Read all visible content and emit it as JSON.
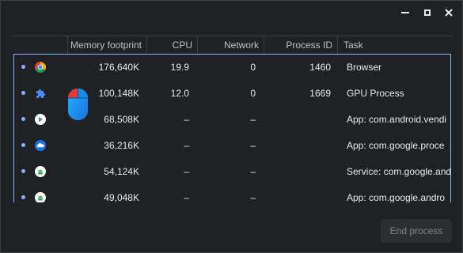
{
  "columns": {
    "memory": "Memory footprint",
    "cpu": "CPU",
    "network": "Network",
    "pid": "Process ID",
    "task": "Task"
  },
  "rows": [
    {
      "icon": "chrome-icon",
      "memory": "176,640K",
      "cpu": "19.9",
      "network": "0",
      "pid": "1460",
      "task": "Browser"
    },
    {
      "icon": "puzzle-piece-icon",
      "memory": "100,148K",
      "cpu": "12.0",
      "network": "0",
      "pid": "1669",
      "task": "GPU Process"
    },
    {
      "icon": "play-store-icon",
      "memory": "68,508K",
      "cpu": "–",
      "network": "–",
      "pid": "",
      "task": "App: com.android.vendi"
    },
    {
      "icon": "cloud-icon",
      "memory": "36,216K",
      "cpu": "–",
      "network": "–",
      "pid": "",
      "task": "App: com.google.proce"
    },
    {
      "icon": "android-icon",
      "memory": "54,124K",
      "cpu": "–",
      "network": "–",
      "pid": "",
      "task": "Service: com.google.and"
    },
    {
      "icon": "android-icon",
      "memory": "49,048K",
      "cpu": "–",
      "network": "–",
      "pid": "",
      "task": "App: com.google.andro"
    }
  ],
  "actions": {
    "end_process": "End process"
  },
  "colors": {
    "background": "#202124",
    "selection_border": "#8ab4f8",
    "text": "#e8eaed",
    "disabled_button": "#2d2e31"
  }
}
